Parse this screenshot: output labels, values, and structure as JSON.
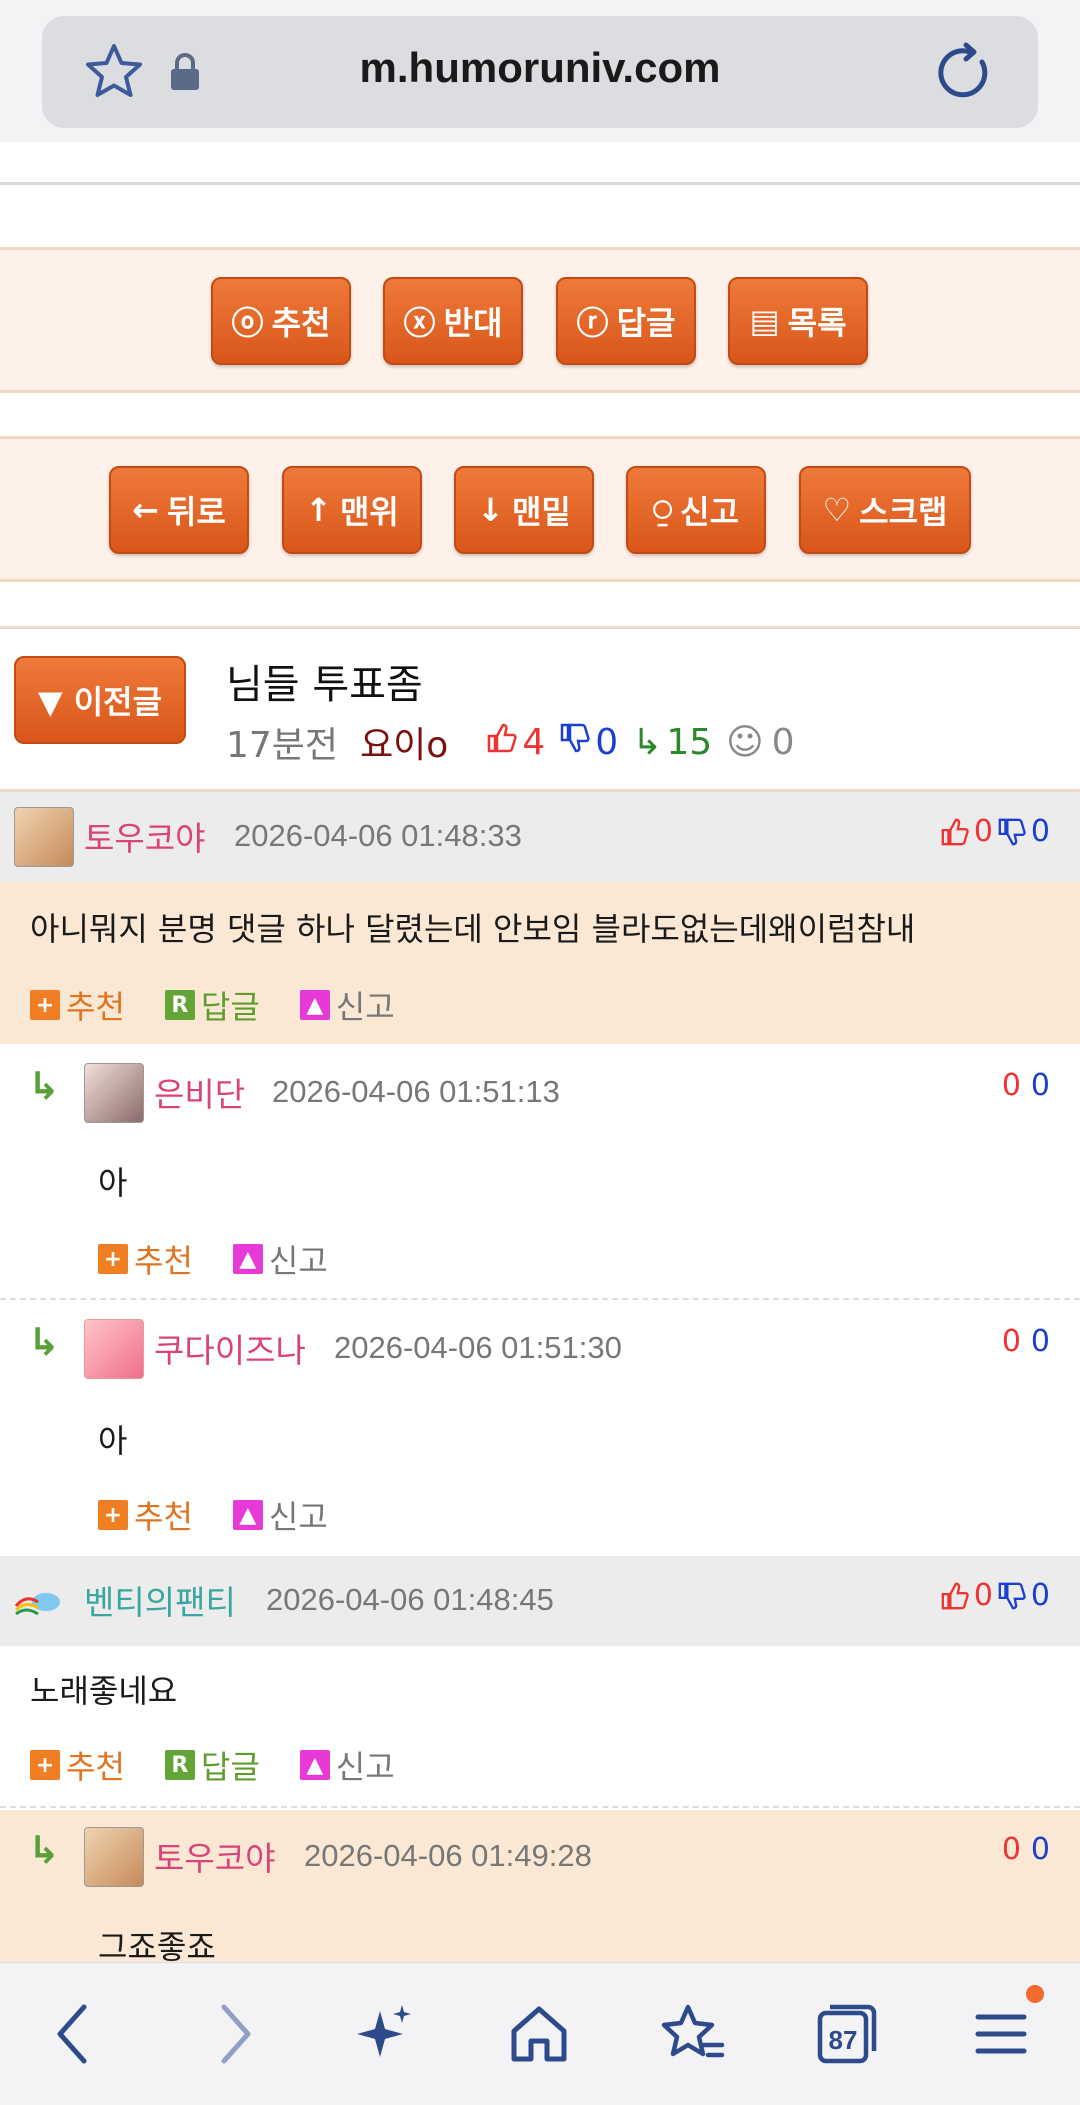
{
  "browser": {
    "url": "m.humoruniv.com",
    "tab_count": "87",
    "icons": [
      "star-outline-icon",
      "lock-icon",
      "reload-icon"
    ]
  },
  "action_bar1": {
    "recommend": "추천",
    "oppose": "반대",
    "reply": "답글",
    "list": "목록"
  },
  "action_bar2": {
    "back": "뒤로",
    "top": "맨위",
    "bottom": "맨밑",
    "report": "신고",
    "scrap": "스크랩"
  },
  "post": {
    "prev_label": "▼ 이전글",
    "title": "님들 투표좀",
    "time": "17분전",
    "author": "요이o",
    "up": "4",
    "down": "0",
    "replies": "15",
    "views": "0"
  },
  "labels": {
    "recommend": "추천",
    "reply": "답글",
    "report": "신고",
    "r_mark": "R",
    "plus_mark": "+"
  },
  "comments": [
    {
      "name": "토우코야",
      "date": "2026-04-06 01:48:33",
      "up": "0",
      "down": "0",
      "text": "아니뭐지 분명 댓글 하나 달렸는데 안보임 블라도없는데왜이럼참내"
    },
    {
      "name": "은비단",
      "date": "2026-04-06 01:51:13",
      "up": "0",
      "down": "0",
      "text": "아"
    },
    {
      "name": "쿠다이즈나",
      "date": "2026-04-06 01:51:30",
      "up": "0",
      "down": "0",
      "text": "아"
    },
    {
      "name": "벤티의팬티",
      "date": "2026-04-06 01:48:45",
      "up": "0",
      "down": "0",
      "text": "노래좋네요"
    },
    {
      "name": "토우코야",
      "date": "2026-04-06 01:49:28",
      "up": "0",
      "down": "0",
      "text": "그죠좋죠"
    }
  ],
  "colors": {
    "accent_orange": "#e0621f",
    "name_pink": "#d9437a",
    "name_teal": "#3aa6a0"
  }
}
